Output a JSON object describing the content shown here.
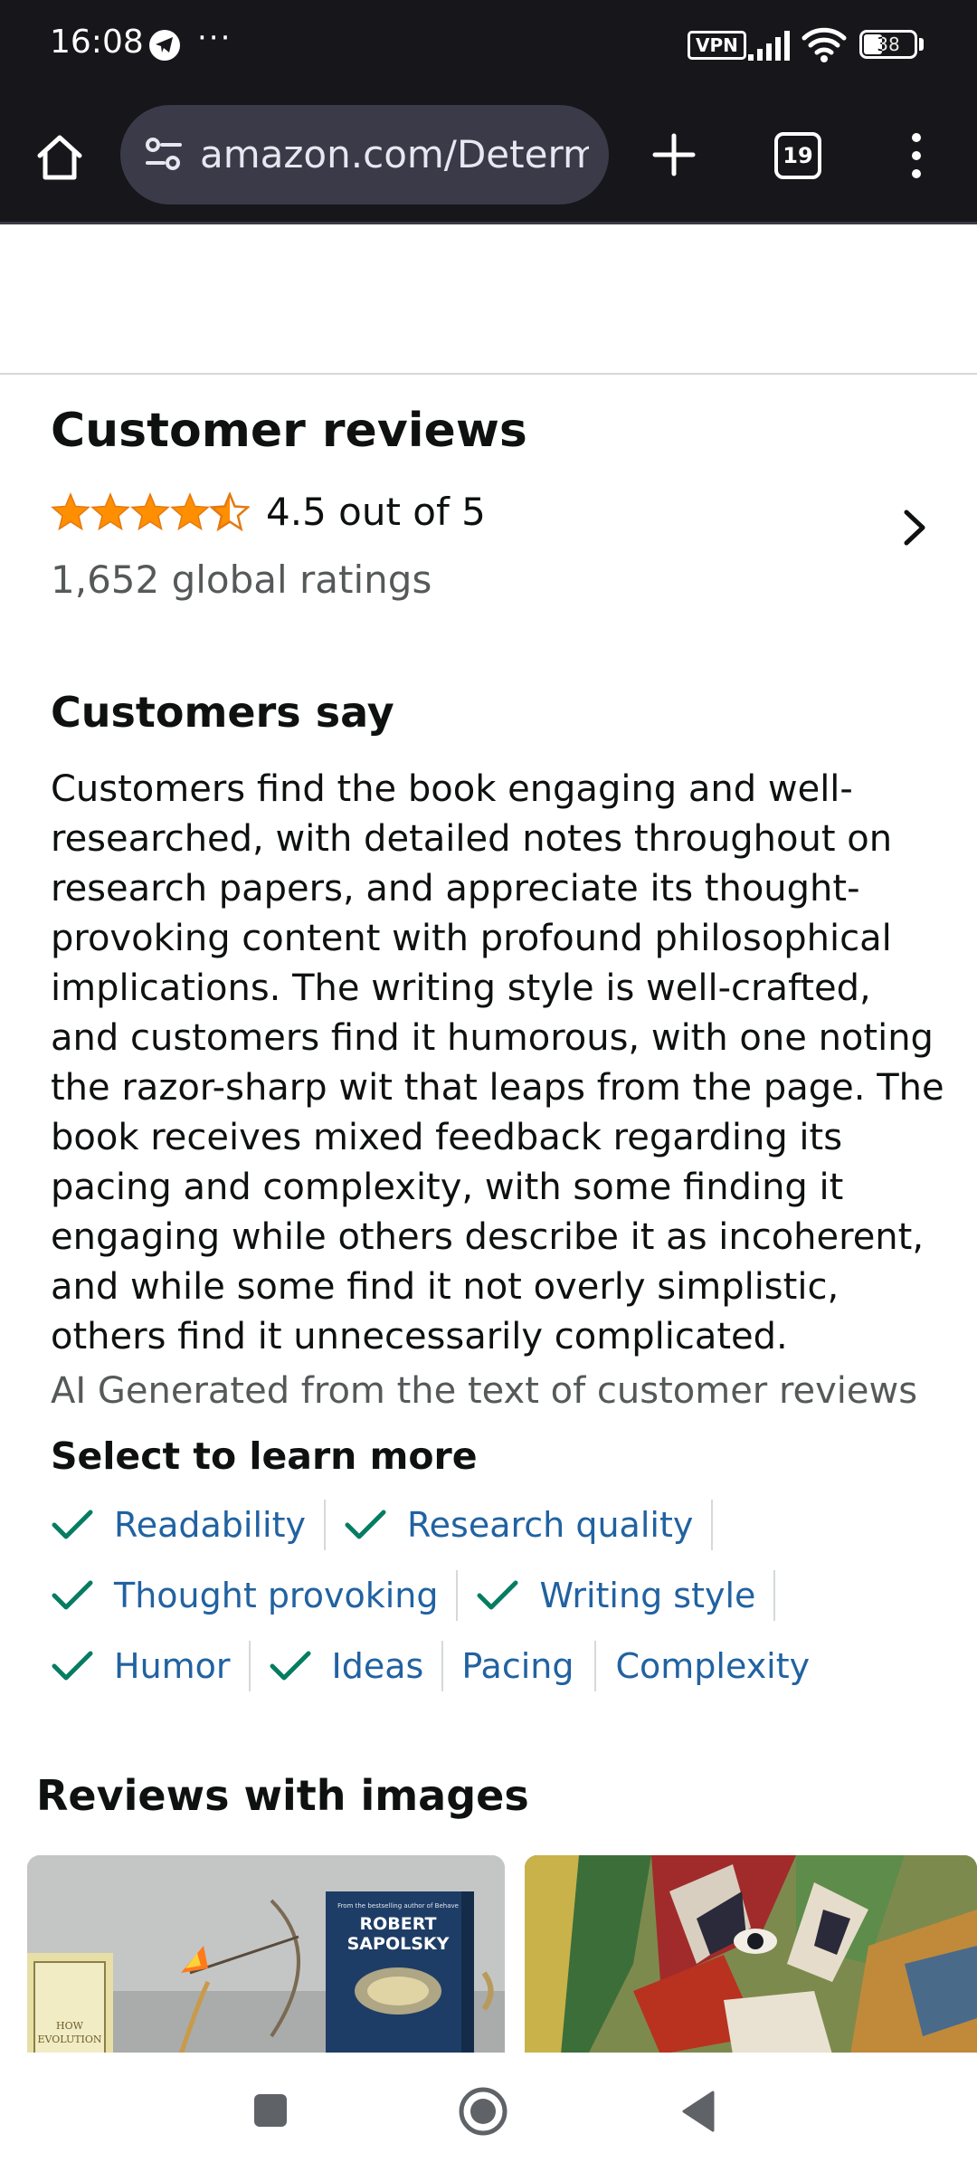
{
  "status_bar": {
    "time": "16:08",
    "more_indicator": "···",
    "vpn_label": "VPN",
    "battery_level": "38",
    "icons": [
      "telegram-icon",
      "signal-icon",
      "wifi-icon",
      "battery-icon"
    ]
  },
  "browser": {
    "url": "amazon.com/Determined",
    "tab_count": "19",
    "icons": [
      "home-icon",
      "site-settings-icon",
      "new-tab-icon",
      "tab-switcher-icon",
      "menu-icon"
    ]
  },
  "reviews": {
    "title": "Customer reviews",
    "rating_value": 4.5,
    "rating_text": "4.5 out of 5",
    "global_ratings": "1,652 global ratings"
  },
  "customers_say": {
    "title": "Customers say",
    "summary": "Customers find the book engaging and well-researched, with detailed notes throughout on research papers, and appreciate its thought-provoking content with profound philosophical implications. The writing style is well-crafted, and customers find it humorous, with one noting the razor-sharp wit that leaps from the page. The book receives mixed feedback regarding its pacing and complexity, with some finding it engaging while others describe it as incoherent, and while some find it not overly simplistic, others find it unnecessarily complicated.",
    "ai_note": "AI Generated from the text of customer reviews",
    "learn_more_title": "Select to learn more",
    "aspects": [
      {
        "label": "Readability",
        "positive": true
      },
      {
        "label": "Research quality",
        "positive": true
      },
      {
        "label": "Thought provoking",
        "positive": true
      },
      {
        "label": "Writing style",
        "positive": true
      },
      {
        "label": "Humor",
        "positive": true
      },
      {
        "label": "Ideas",
        "positive": true
      },
      {
        "label": "Pacing",
        "positive": false
      },
      {
        "label": "Complexity",
        "positive": false
      }
    ]
  },
  "reviews_with_images": {
    "title": "Reviews with images",
    "image1_text": {
      "tagline": "From the bestselling author of Behave",
      "author_line1": "ROBERT",
      "author_line2": "SAPOLSKY",
      "side_book_line1": "HOW",
      "side_book_line2": "EVOLUTION"
    }
  },
  "colors": {
    "star": "#ff8f00",
    "link": "#2162a1",
    "check": "#067d62",
    "browser_bar": "#16161b"
  }
}
